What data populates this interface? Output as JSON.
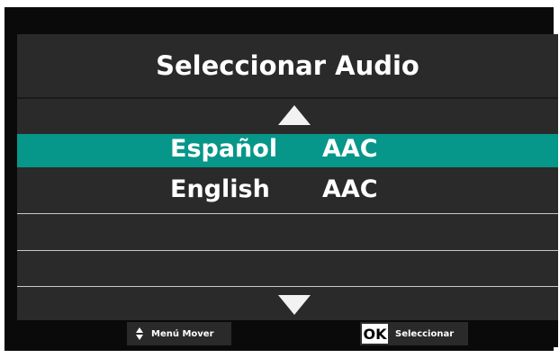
{
  "dialog": {
    "title": "Seleccionar Audio",
    "tracks": [
      {
        "language": "Español",
        "codec": "AAC",
        "selected": true
      },
      {
        "language": "English",
        "codec": "AAC",
        "selected": false
      }
    ]
  },
  "footer": {
    "move_label": "Menú Mover",
    "ok_key": "OK",
    "select_label": "Seleccionar"
  },
  "colors": {
    "highlight": "#07968a",
    "dialog_bg": "#2a2a2a",
    "frame_bg": "#0a0a0a"
  }
}
